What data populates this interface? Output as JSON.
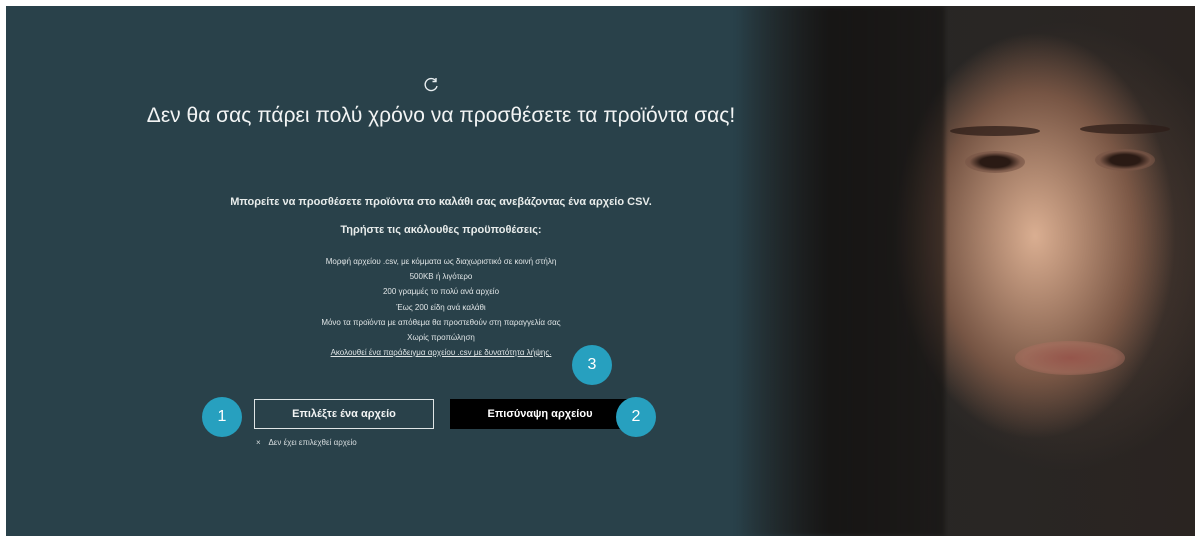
{
  "page": {
    "refresh_icon": "refresh-icon",
    "headline": "Δεν θα σας πάρει πολύ χρόνο να προσθέσετε τα προϊόντα σας!",
    "lead": "Μπορείτε να προσθέσετε προϊόντα στο καλάθι σας ανεβάζοντας ένα αρχείο CSV.",
    "subhead": "Τηρήστε τις ακόλουθες προϋποθέσεις:",
    "requirements": [
      "Μορφή αρχείου .csv, με κόμματα ως διαχωριστικό σε κοινή στήλη",
      "500KB ή λιγότερο",
      "200 γραμμές το πολύ ανά αρχείο",
      "Έως 200 είδη ανά καλάθι",
      "Μόνο τα προϊόντα με απόθεμα θα προστεθούν στη παραγγελία σας",
      "Χωρίς προπώληση"
    ],
    "sample_link_text": "Ακολουθεί ένα παράδειγμα αρχείου .csv με δυνατότητα λήψης."
  },
  "actions": {
    "choose_file_label": "Επιλέξτε ένα αρχείο",
    "upload_label": "Επισύναψη αρχείου",
    "no_file_mark": "×",
    "no_file_text": "Δεν έχει επιλεχθεί αρχείο"
  },
  "annotations": {
    "badge_1": "1",
    "badge_2": "2",
    "badge_3": "3"
  },
  "colors": {
    "background": "#29414a",
    "badge": "#27a0bf",
    "upload_button": "#000000",
    "text": "#f2f4f4"
  }
}
